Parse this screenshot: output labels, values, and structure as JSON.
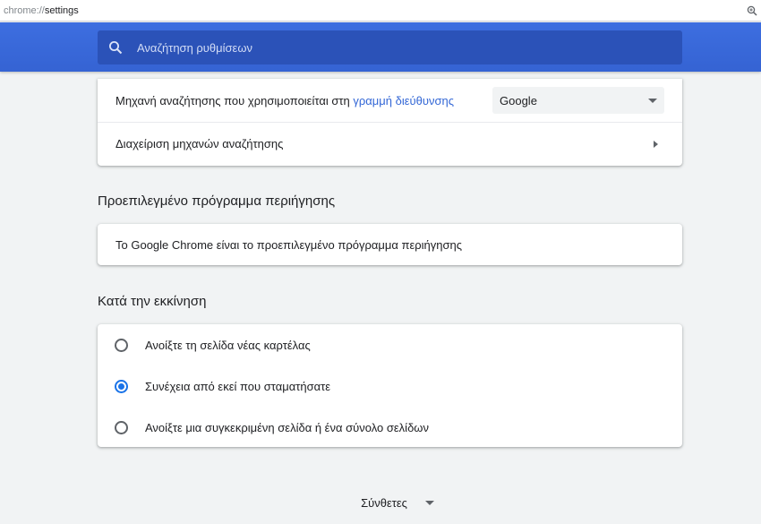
{
  "address_bar": {
    "scheme": "chrome://",
    "path": "settings"
  },
  "search": {
    "placeholder": "Αναζήτηση ρυθμίσεων"
  },
  "search_engine": {
    "label_prefix": "Μηχανή αναζήτησης που χρησιμοποιείται στη ",
    "label_link": "γραμμή διεύθυνσης",
    "selected": "Google",
    "manage_label": "Διαχείριση μηχανών αναζήτησης"
  },
  "default_browser": {
    "title": "Προεπιλεγμένο πρόγραμμα περιήγησης",
    "status": "Το Google Chrome είναι το προεπιλεγμένο πρόγραμμα περιήγησης"
  },
  "startup": {
    "title": "Κατά την εκκίνηση",
    "options": [
      {
        "label": "Ανοίξτε τη σελίδα νέας καρτέλας",
        "checked": false
      },
      {
        "label": "Συνέχεια από εκεί που σταματήσατε",
        "checked": true
      },
      {
        "label": "Ανοίξτε μια συγκεκριμένη σελίδα ή ένα σύνολο σελίδων",
        "checked": false
      }
    ]
  },
  "advanced": {
    "label": "Σύνθετες"
  },
  "colors": {
    "header": "#3d6ee0",
    "search_box": "#2b52b8",
    "accent": "#1a73e8",
    "link": "#3367d6"
  }
}
